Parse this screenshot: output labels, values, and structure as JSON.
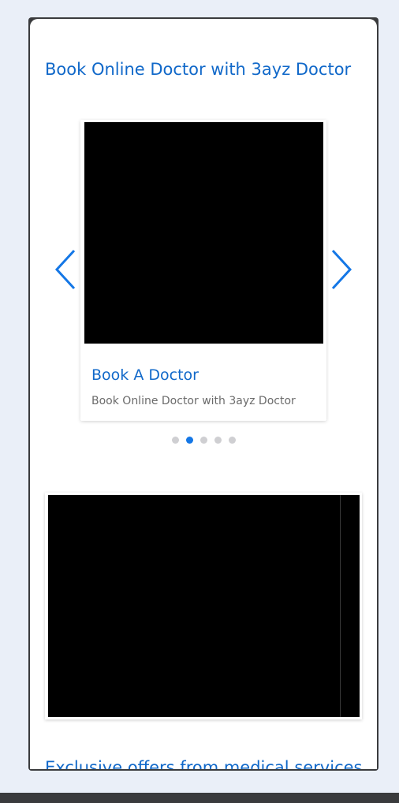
{
  "page": {
    "title": "Book Online Doctor with 3ayz Doctor"
  },
  "carousel": {
    "prev_icon": "chevron-left-icon",
    "next_icon": "chevron-right-icon",
    "active_slide": {
      "title": "Book A Doctor",
      "subtitle": "Book Online Doctor with 3ayz Doctor"
    },
    "dots_total": 5,
    "active_dot_index": 1
  },
  "sections": {
    "offers_title": "Exclusive offers from medical services"
  },
  "colors": {
    "accent": "#1068c9",
    "arrow": "#1477e6",
    "dot_active": "#1477e6",
    "dot_inactive": "#cfcfd2",
    "background": "#eaeff8",
    "frame": "#3a3b3d"
  }
}
